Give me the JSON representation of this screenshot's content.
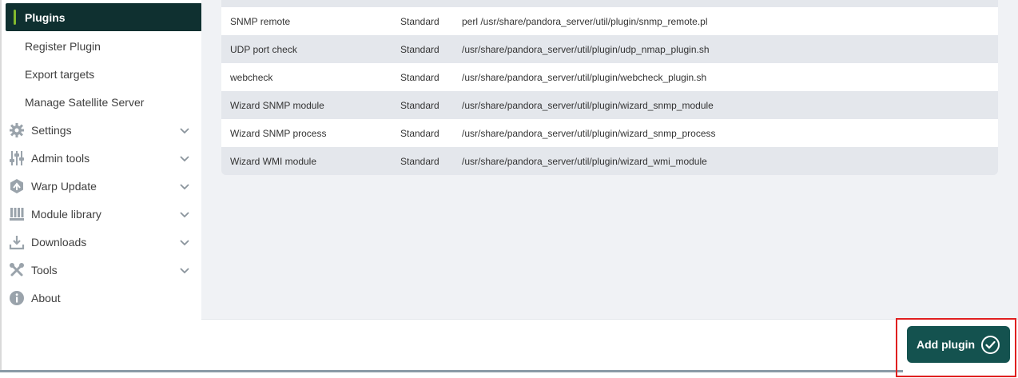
{
  "sidebar": {
    "active_item": "Plugins",
    "sub_items": [
      {
        "label": "Register Plugin"
      },
      {
        "label": "Export targets"
      },
      {
        "label": "Manage Satellite Server"
      }
    ],
    "menu": [
      {
        "label": "Settings",
        "icon": "gear-icon"
      },
      {
        "label": "Admin tools",
        "icon": "sliders-icon"
      },
      {
        "label": "Warp Update",
        "icon": "warp-update-icon"
      },
      {
        "label": "Module library",
        "icon": "module-library-icon"
      },
      {
        "label": "Downloads",
        "icon": "download-icon"
      },
      {
        "label": "Tools",
        "icon": "tools-icon"
      },
      {
        "label": "About",
        "icon": "info-icon"
      }
    ]
  },
  "plugins_table": {
    "rows": [
      {
        "name": "SNMP remote",
        "type": "Standard",
        "command": "perl /usr/share/pandora_server/util/plugin/snmp_remote.pl"
      },
      {
        "name": "UDP port check",
        "type": "Standard",
        "command": "/usr/share/pandora_server/util/plugin/udp_nmap_plugin.sh"
      },
      {
        "name": "webcheck",
        "type": "Standard",
        "command": "/usr/share/pandora_server/util/plugin/webcheck_plugin.sh"
      },
      {
        "name": "Wizard SNMP module",
        "type": "Standard",
        "command": "/usr/share/pandora_server/util/plugin/wizard_snmp_module"
      },
      {
        "name": "Wizard SNMP process",
        "type": "Standard",
        "command": "/usr/share/pandora_server/util/plugin/wizard_snmp_process"
      },
      {
        "name": "Wizard WMI module",
        "type": "Standard",
        "command": "/usr/share/pandora_server/util/plugin/wizard_wmi_module"
      }
    ]
  },
  "actions": {
    "add_plugin_label": "Add plugin",
    "add_plugin_icon": "check-circle-icon"
  },
  "colors": {
    "active_nav_bg": "#0f3030",
    "active_nav_accent": "#82b92e",
    "button_bg": "#14524f",
    "highlight_border": "#e02020"
  }
}
